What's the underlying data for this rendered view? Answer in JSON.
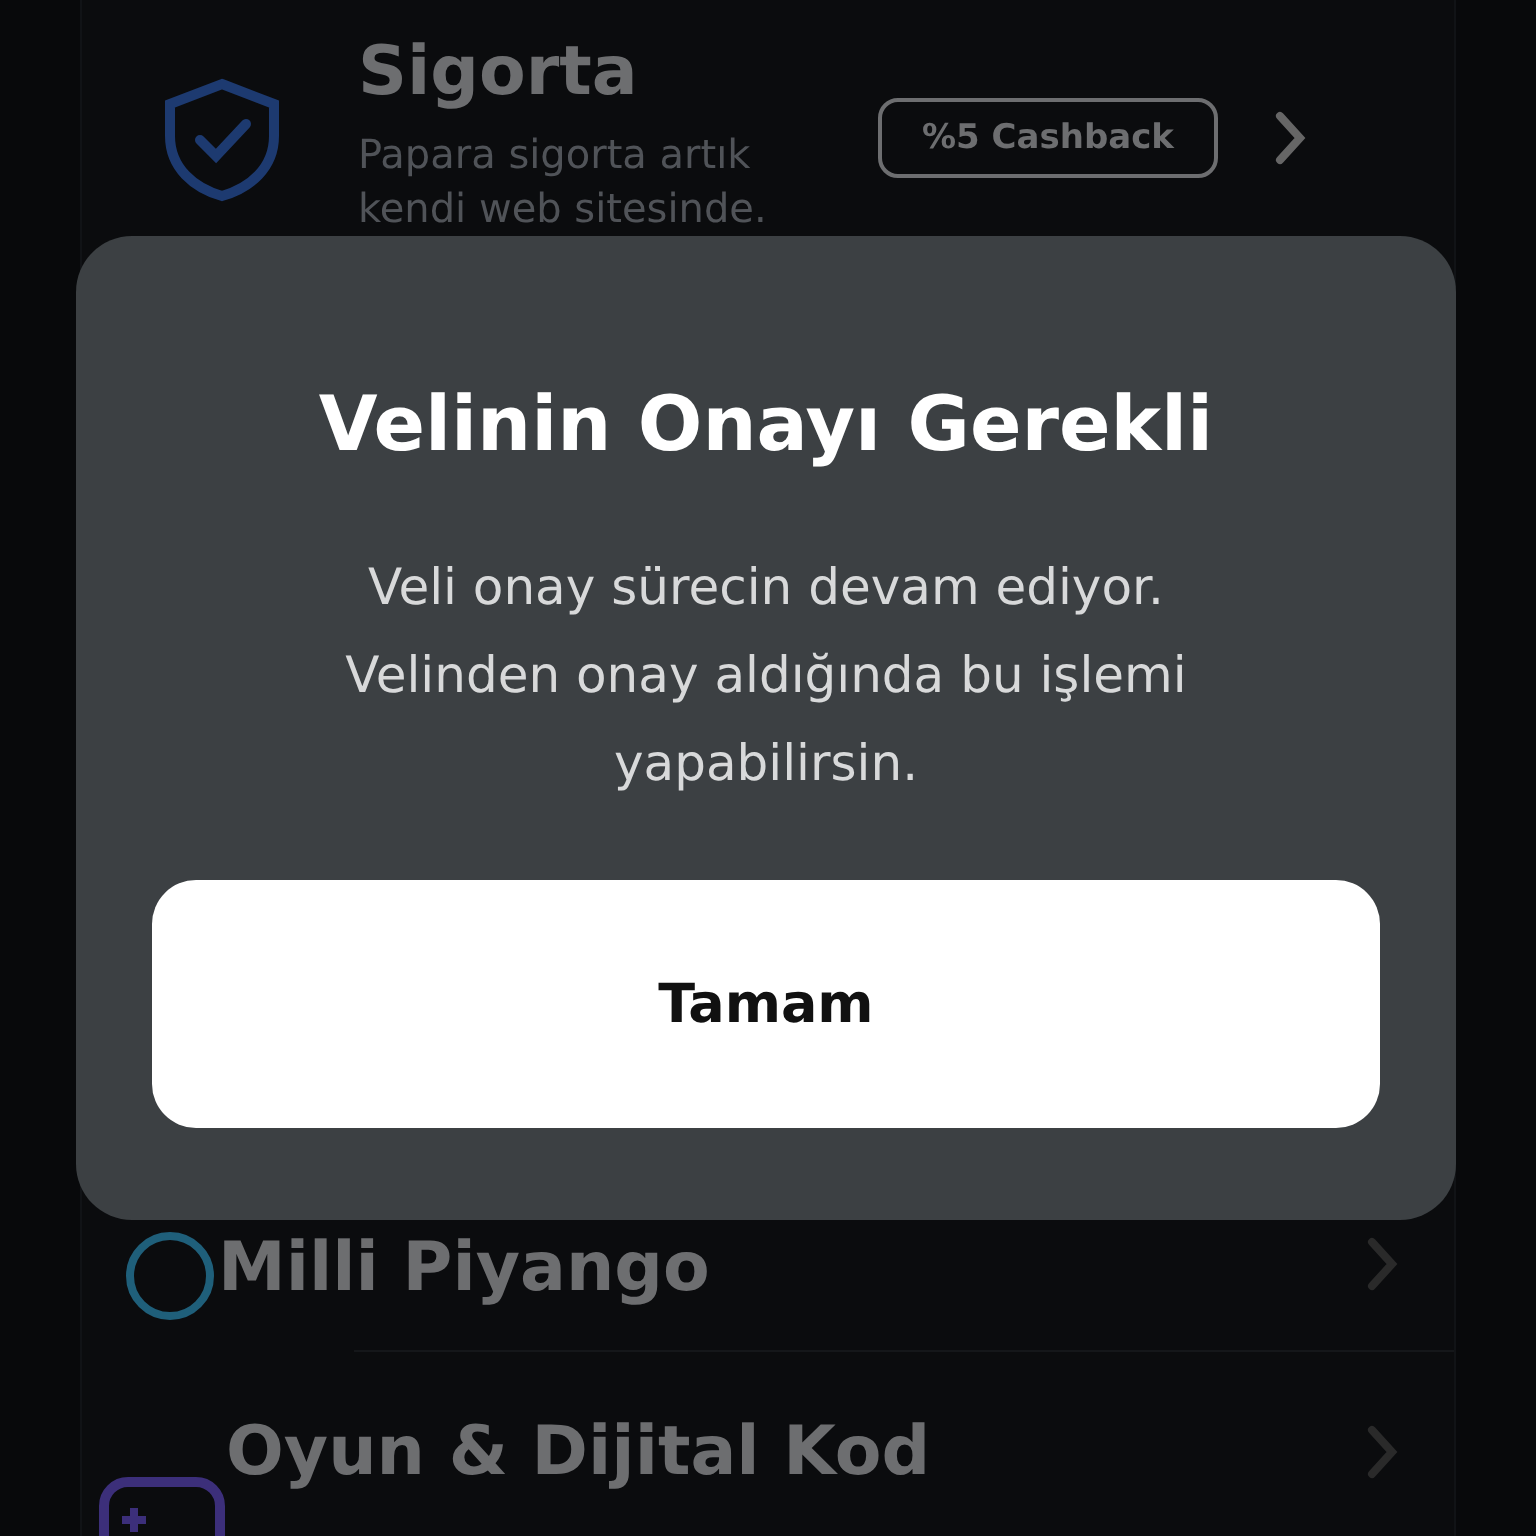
{
  "list": [
    {
      "kind": "insurance",
      "title": "Sigorta",
      "subtitle": "Papara sigorta artık kendi web sitesinde.",
      "badge": "%5 Cashback"
    },
    {
      "kind": "empty"
    },
    {
      "kind": "empty"
    },
    {
      "kind": "lottery",
      "title": "Milli Piyango"
    },
    {
      "kind": "game",
      "title": "Oyun & Dijital Kod"
    }
  ],
  "dialog": {
    "title": "Velinin Onayı Gerekli",
    "message": "Veli onay sürecin devam ediyor. Velinden onay aldığında bu işlemi yapabilirsin.",
    "button": "Tamam"
  }
}
